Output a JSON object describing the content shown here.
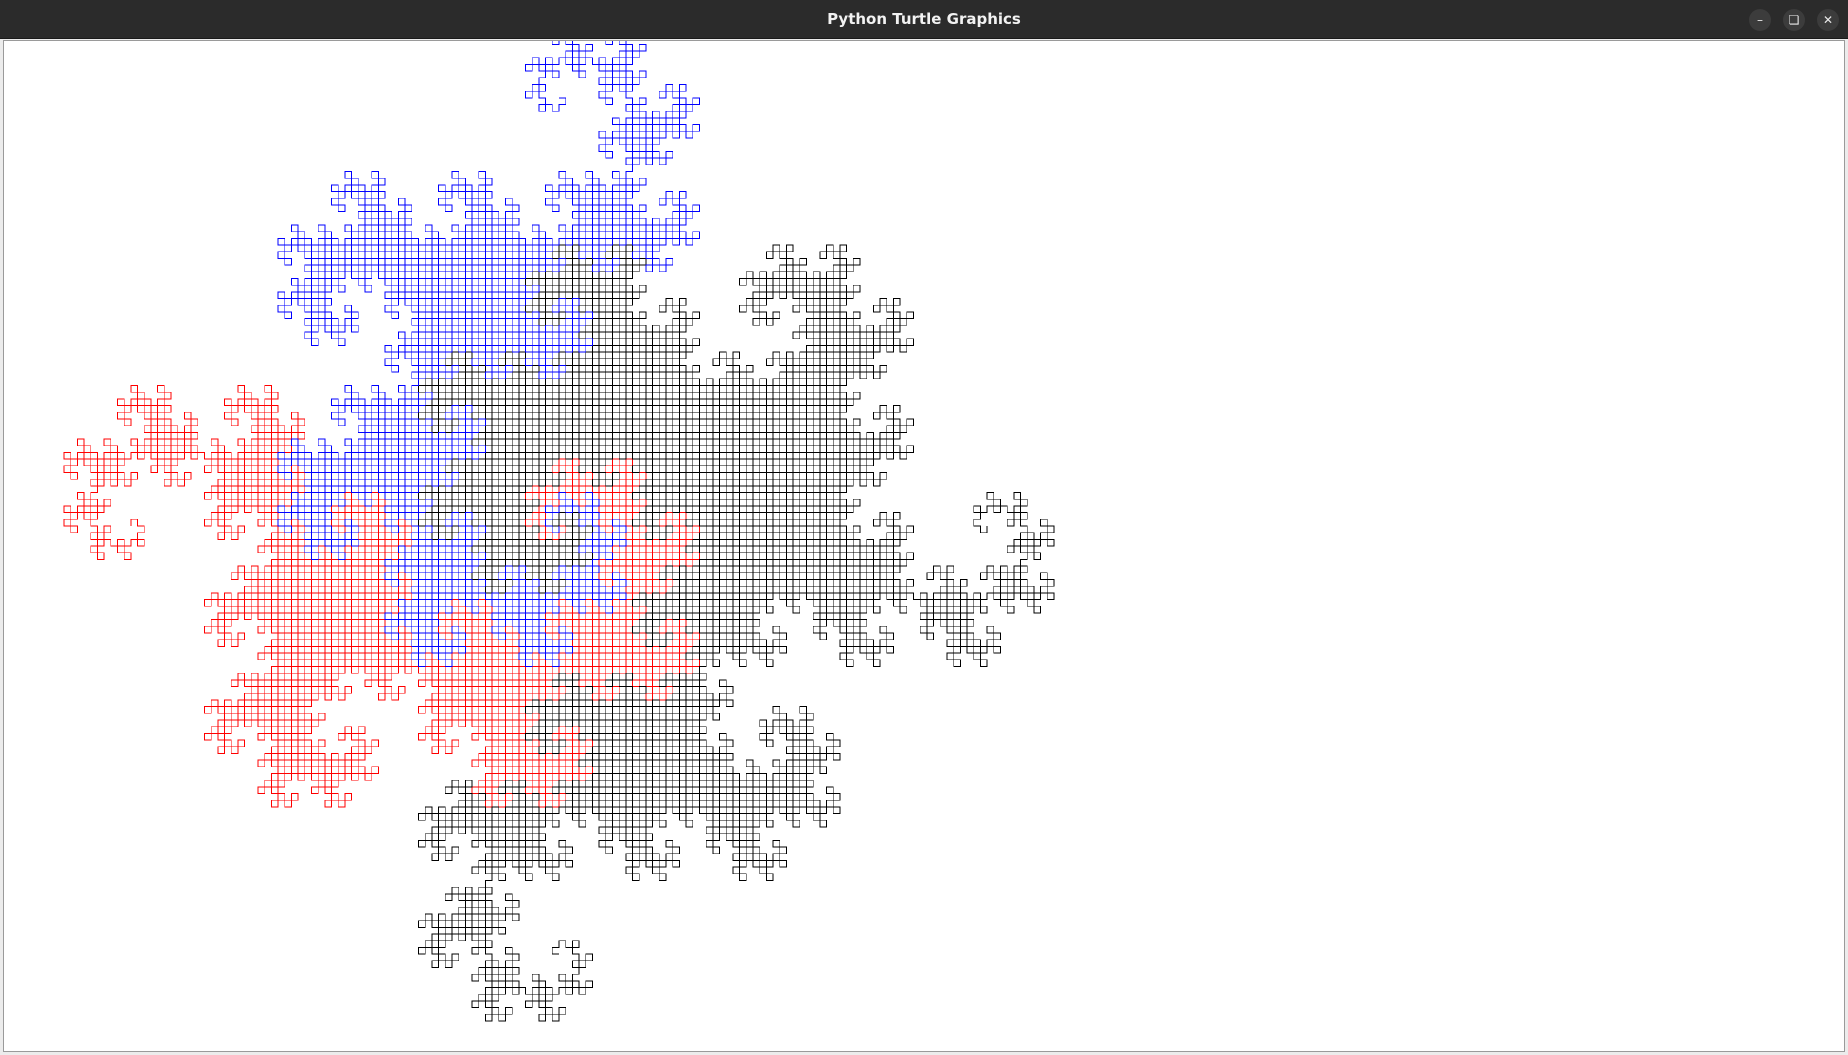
{
  "window": {
    "title": "Python Turtle Graphics",
    "controls": {
      "minimize_icon": "minimize-icon",
      "restore_icon": "restore-icon",
      "close_icon": "close-icon"
    }
  },
  "canvas": {
    "background": "#ffffff",
    "drawing": "dragon-curve fractal",
    "pen_colors": [
      "#ff0000",
      "#0000ff",
      "#000000"
    ]
  }
}
